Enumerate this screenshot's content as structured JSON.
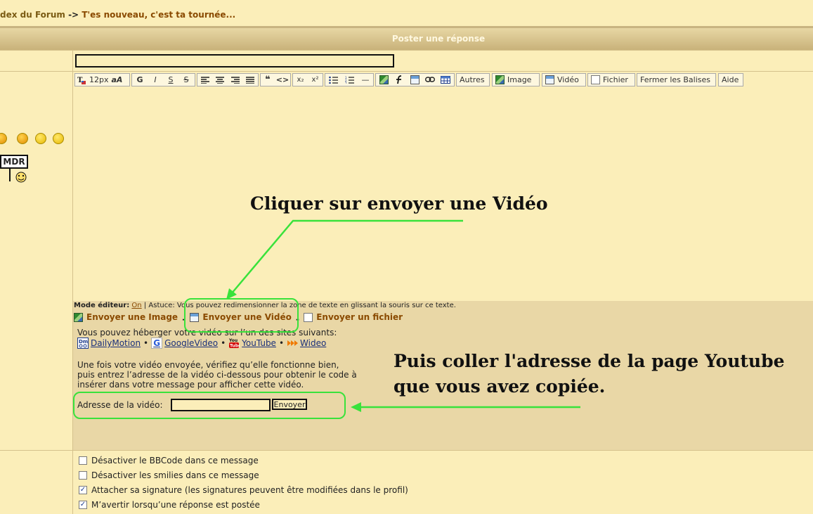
{
  "breadcrumb": {
    "index": "dex du Forum",
    "separator": "->",
    "current": "T'es nouveau, c'est ta tournée..."
  },
  "header": {
    "title": "Poster une réponse"
  },
  "subject": {
    "value": ""
  },
  "toolbar": {
    "size_label": "12px",
    "size_alt_label": "aA",
    "bold": "G",
    "italic": "I",
    "underline": "S",
    "strike": "S",
    "quote": "❝",
    "code": "<>",
    "sub": "x₂",
    "sup": "x²",
    "hr": "—",
    "others": "Autres",
    "image": "Image",
    "video": "Vidéo",
    "file": "Fichier",
    "close_tags": "Fermer les Balises",
    "help": "Aide"
  },
  "sidebar": {
    "mdr": "MDR"
  },
  "editor": {
    "value": ""
  },
  "mode": {
    "label": "Mode éditeur:",
    "value": "On",
    "sep": "|",
    "tip": "Astuce: Vous pouvez redimensionner la zone de texte en glissant la souris sur ce texte."
  },
  "upload": {
    "tab_image": "Envoyer une Image",
    "tab_video": "Envoyer une Vidéo",
    "tab_file": "Envoyer un fichier",
    "dash": "-",
    "intro": "Vous pouvez héberger votre vidéo sur l’un des sites suivants:",
    "sites": [
      "DailyMotion",
      "GoogleVideo",
      "YouTube",
      "Wideo"
    ],
    "bullet": "•",
    "help_line1": "Une fois votre vidéo envoyée, vérifiez qu’elle fonctionne bien,",
    "help_line2": "puis entrez l’adresse de la vidéo ci-dessous pour obtenir le code à",
    "help_line3": "insérer dans votre message pour afficher cette vidéo.",
    "url_label": "Adresse de la vidéo:",
    "url_value": "",
    "send_label": "Envoyer"
  },
  "annotations": {
    "click_video": "Cliquer sur envoyer une Vidéo",
    "paste_line1": "Puis coller l'adresse de la page Youtube",
    "paste_line2": "que vous avez copiée.",
    "color": "#39e23b"
  },
  "options": [
    {
      "label": "Désactiver le BBCode dans ce message",
      "checked": false
    },
    {
      "label": "Désactiver les smilies dans ce message",
      "checked": false
    },
    {
      "label": "Attacher sa signature (les signatures peuvent être modifiées dans le profil)",
      "checked": true
    },
    {
      "label": "M’avertir lorsqu’une réponse est postée",
      "checked": true
    }
  ],
  "check_mark": "✓",
  "colors": {
    "background": "#fbeeb9",
    "panel": "#e9d7a6",
    "link": "#8a4a00",
    "highlight": "#39e23b"
  }
}
